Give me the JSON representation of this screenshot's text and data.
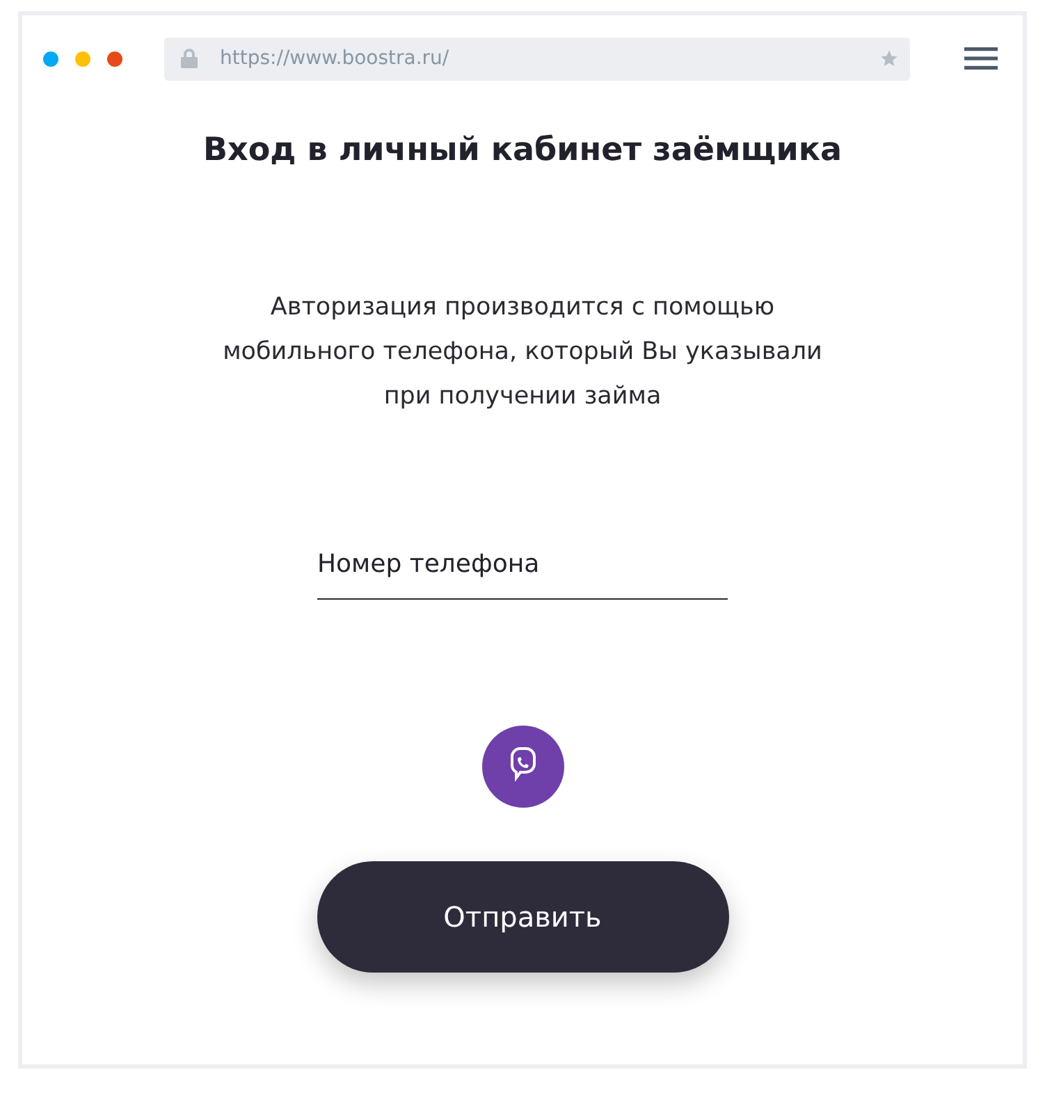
{
  "browser": {
    "dots": [
      {
        "color": "#03a9f4"
      },
      {
        "color": "#ffc107"
      },
      {
        "color": "#e64a19"
      }
    ],
    "url": "https://www.boostra.ru/"
  },
  "title": "Вход в личный кабинет заёмщика",
  "description": "Авторизация производится с помощью мобильного телефона, который Вы указывали при получении займа",
  "phone_field": {
    "placeholder": "Номер телефона"
  },
  "submit_button": "Отправить"
}
